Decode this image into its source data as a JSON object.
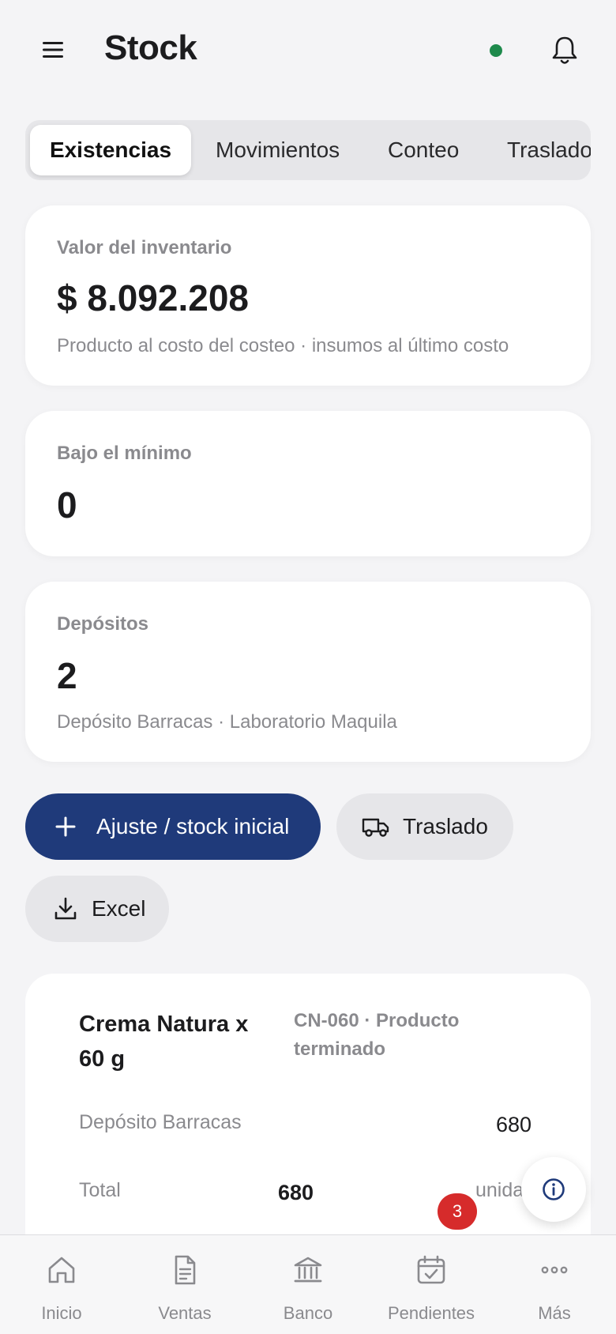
{
  "header": {
    "title": "Stock"
  },
  "tabs": [
    {
      "label": "Existencias"
    },
    {
      "label": "Movimientos"
    },
    {
      "label": "Conteo"
    },
    {
      "label": "Traslado"
    }
  ],
  "cards": {
    "inventory": {
      "label": "Valor del inventario",
      "value": "$ 8.092.208",
      "sub": "Producto al costo del costeo · insumos al último costo"
    },
    "below_min": {
      "label": "Bajo el mínimo",
      "value": "0"
    },
    "deposits": {
      "label": "Depósitos",
      "value": "2",
      "sub": "Depósito Barracas · Laboratorio Maquila"
    }
  },
  "actions": {
    "adjust": "Ajuste / stock inicial",
    "transfer": "Traslado",
    "excel": "Excel"
  },
  "product": {
    "name": "Crema Natura x 60 g",
    "code": "CN-060 · Producto terminado",
    "rows": [
      {
        "label": "Depósito Barracas",
        "value": "680"
      },
      {
        "label": "Total",
        "value": "680",
        "unit": "unida"
      }
    ]
  },
  "nav": [
    {
      "label": "Inicio"
    },
    {
      "label": "Ventas"
    },
    {
      "label": "Banco"
    },
    {
      "label": "Pendientes",
      "badge": "3"
    },
    {
      "label": "Más"
    }
  ],
  "colors": {
    "primary": "#1f3a7a",
    "status_online": "#1e8a4c",
    "badge": "#d62b2b"
  }
}
